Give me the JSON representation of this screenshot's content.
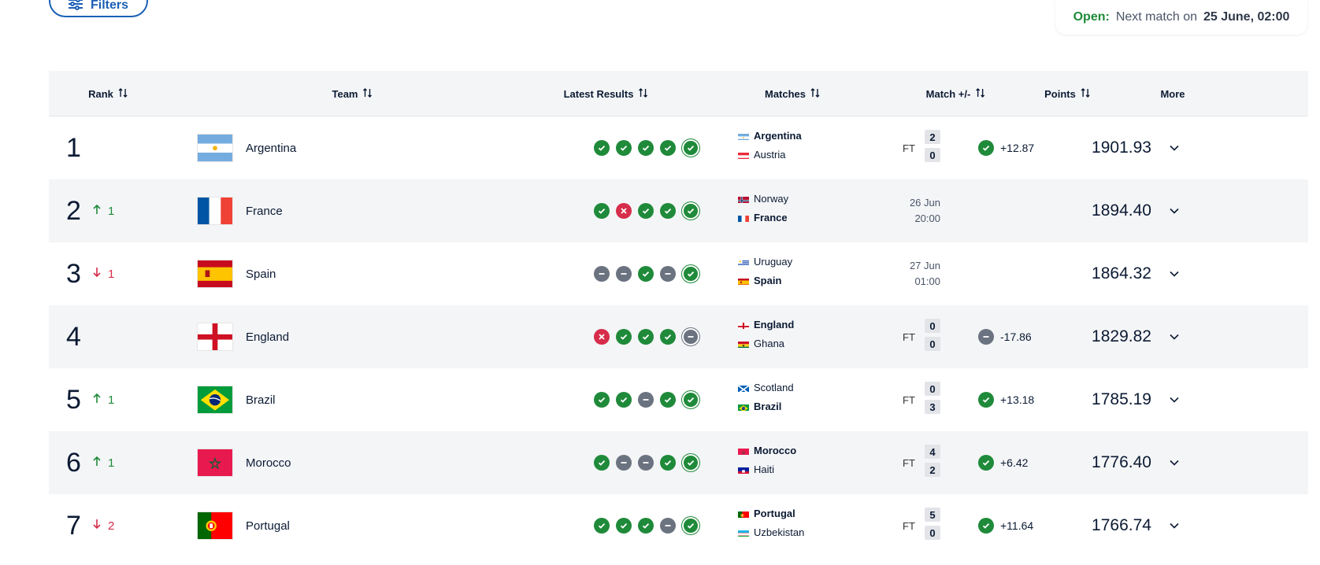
{
  "filters": {
    "label": "Filters"
  },
  "status": {
    "open_label": "Open:",
    "text": "Next match on",
    "datetime": "25 June, 02:00"
  },
  "columns": {
    "rank": "Rank",
    "team": "Team",
    "latest_results": "Latest Results",
    "matches": "Matches",
    "match_delta": "Match +/-",
    "points": "Points",
    "more": "More"
  },
  "colors": {
    "win": "#1f8a3a",
    "loss": "#d62d4b",
    "draw": "#6b7280",
    "accent": "#1a5fb4"
  },
  "rows": [
    {
      "rank": "1",
      "move_dir": "",
      "move": "",
      "team": "Argentina",
      "flag": "argentina",
      "results": [
        "win",
        "win",
        "win",
        "win",
        "win"
      ],
      "match": {
        "team1": "Argentina",
        "flag1": "argentina",
        "team2": "Austria",
        "flag2": "austria",
        "bold": 1,
        "status": "FT",
        "score1": "2",
        "score2": "0",
        "date": "",
        "time": ""
      },
      "delta_result": "win",
      "delta": "+12.87",
      "points": "1901.93"
    },
    {
      "rank": "2",
      "move_dir": "up",
      "move": "1",
      "team": "France",
      "flag": "france",
      "results": [
        "win",
        "loss",
        "win",
        "win",
        "win"
      ],
      "match": {
        "team1": "Norway",
        "flag1": "norway",
        "team2": "France",
        "flag2": "france",
        "bold": 2,
        "status": "",
        "score1": "",
        "score2": "",
        "date": "26 Jun",
        "time": "20:00"
      },
      "delta_result": "",
      "delta": "",
      "points": "1894.40"
    },
    {
      "rank": "3",
      "move_dir": "down",
      "move": "1",
      "team": "Spain",
      "flag": "spain",
      "results": [
        "draw",
        "draw",
        "win",
        "draw",
        "win"
      ],
      "match": {
        "team1": "Uruguay",
        "flag1": "uruguay",
        "team2": "Spain",
        "flag2": "spain",
        "bold": 2,
        "status": "",
        "score1": "",
        "score2": "",
        "date": "27 Jun",
        "time": "01:00"
      },
      "delta_result": "",
      "delta": "",
      "points": "1864.32"
    },
    {
      "rank": "4",
      "move_dir": "",
      "move": "",
      "team": "England",
      "flag": "england",
      "results": [
        "loss",
        "win",
        "win",
        "win",
        "draw"
      ],
      "match": {
        "team1": "England",
        "flag1": "england",
        "team2": "Ghana",
        "flag2": "ghana",
        "bold": 1,
        "status": "FT",
        "score1": "0",
        "score2": "0",
        "date": "",
        "time": ""
      },
      "delta_result": "draw",
      "delta": "-17.86",
      "points": "1829.82"
    },
    {
      "rank": "5",
      "move_dir": "up",
      "move": "1",
      "team": "Brazil",
      "flag": "brazil",
      "results": [
        "win",
        "win",
        "draw",
        "win",
        "win"
      ],
      "match": {
        "team1": "Scotland",
        "flag1": "scotland",
        "team2": "Brazil",
        "flag2": "brazil",
        "bold": 2,
        "status": "FT",
        "score1": "0",
        "score2": "3",
        "date": "",
        "time": ""
      },
      "delta_result": "win",
      "delta": "+13.18",
      "points": "1785.19"
    },
    {
      "rank": "6",
      "move_dir": "up",
      "move": "1",
      "team": "Morocco",
      "flag": "morocco",
      "results": [
        "win",
        "draw",
        "draw",
        "win",
        "win"
      ],
      "match": {
        "team1": "Morocco",
        "flag1": "morocco",
        "team2": "Haiti",
        "flag2": "haiti",
        "bold": 1,
        "status": "FT",
        "score1": "4",
        "score2": "2",
        "date": "",
        "time": ""
      },
      "delta_result": "win",
      "delta": "+6.42",
      "points": "1776.40"
    },
    {
      "rank": "7",
      "move_dir": "down",
      "move": "2",
      "team": "Portugal",
      "flag": "portugal",
      "results": [
        "win",
        "win",
        "win",
        "draw",
        "win"
      ],
      "match": {
        "team1": "Portugal",
        "flag1": "portugal",
        "team2": "Uzbekistan",
        "flag2": "uzbekistan",
        "bold": 1,
        "status": "FT",
        "score1": "5",
        "score2": "0",
        "date": "",
        "time": ""
      },
      "delta_result": "win",
      "delta": "+11.64",
      "points": "1766.74"
    }
  ]
}
